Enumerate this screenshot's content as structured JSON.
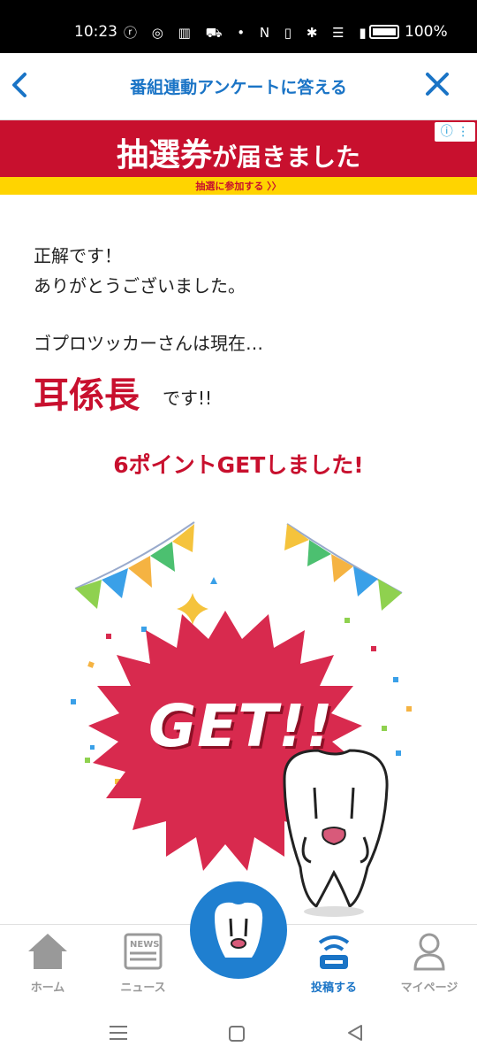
{
  "status_bar": {
    "time": "10:23",
    "icons_text": "ⓡ ◎ ▥ ⛟ •   N ▯ ✱ ☰ ▮",
    "battery": "100%"
  },
  "header": {
    "title": "番組連動アンケートに答える"
  },
  "banner": {
    "main_big": "抽選券",
    "main_small": "が届きました",
    "sub": "抽選に参加する 〉〉",
    "ad_info": "ⓘ ⋮"
  },
  "result": {
    "line1": "正解です！",
    "line2": "ありがとうございました。",
    "status_prefix": "ゴプロツッカーさんは現在…",
    "rank": "耳係長",
    "rank_suffix": "です!!",
    "points_msg": "6ポイントGETしました!"
  },
  "illustration": {
    "get_text": "GET!!"
  },
  "bottom_nav": {
    "items": [
      {
        "label": "ホーム"
      },
      {
        "label": "ニュース"
      },
      {
        "label": "投稿する"
      },
      {
        "label": "マイページ"
      }
    ]
  },
  "colors": {
    "accent": "#1a74c6",
    "red": "#c8102e",
    "burst": "#d82a4e",
    "yellow": "#ffd400"
  }
}
